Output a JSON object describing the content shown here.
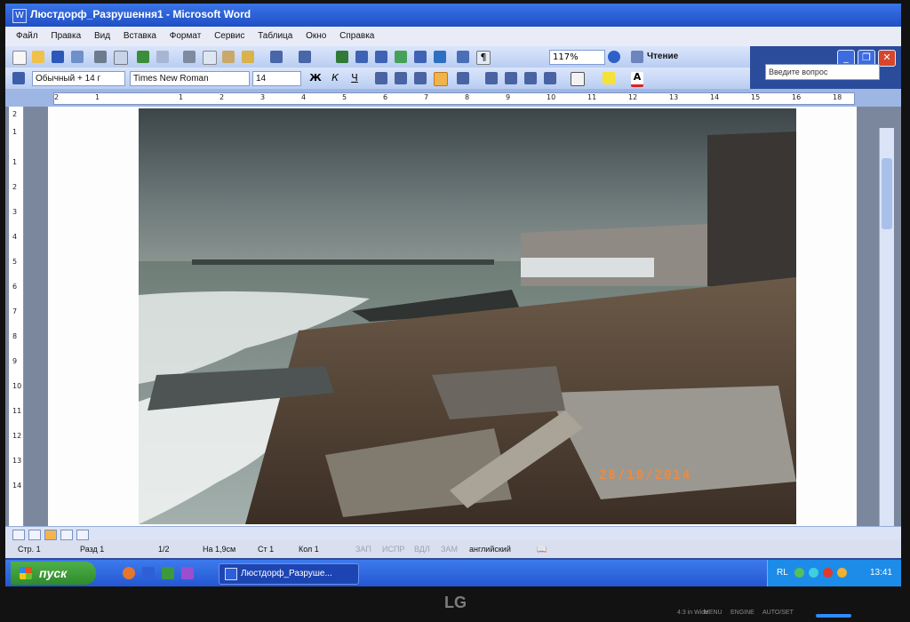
{
  "window": {
    "title": "Люстдорф_Разрушення1 - Microsoft Word"
  },
  "menu": {
    "items": [
      "Файл",
      "Правка",
      "Вид",
      "Вставка",
      "Формат",
      "Сервис",
      "Таблица",
      "Окно",
      "Справка"
    ],
    "help_placeholder": "Введите вопрос"
  },
  "formatting": {
    "style": "Обычный + 14 г",
    "font": "Times New Roman",
    "size": "14",
    "zoom": "117%",
    "reading_label": "Чтение"
  },
  "ruler": {
    "numbers": [
      "2",
      "1",
      "1",
      "2",
      "3",
      "4",
      "5",
      "6",
      "7",
      "8",
      "9",
      "10",
      "11",
      "12",
      "13",
      "14",
      "15",
      "16",
      "18"
    ],
    "vertical_numbers": [
      "2",
      "1",
      "1",
      "2",
      "3",
      "4",
      "5",
      "6",
      "7",
      "8",
      "9",
      "10",
      "11",
      "12",
      "13",
      "14"
    ]
  },
  "document": {
    "photo_date": "28/10/2014"
  },
  "status": {
    "page": "Стр. 1",
    "section": "Разд 1",
    "pages": "1/2",
    "at": "На 1,9см",
    "line": "Ст 1",
    "column": "Кол 1",
    "rec": "ЗАП",
    "trk": "ИСПР",
    "ext": "ВДЛ",
    "ovr": "ЗАМ",
    "language": "английский"
  },
  "taskbar": {
    "start_label": "пуск",
    "task_label": "Люстдорф_Разруше...",
    "lang": "RL",
    "clock": "13:41"
  },
  "bezel": {
    "brand": "LG",
    "labels": [
      "4:3 in Wide",
      "MENU",
      "ENGINE",
      "AUTO/SET"
    ]
  }
}
